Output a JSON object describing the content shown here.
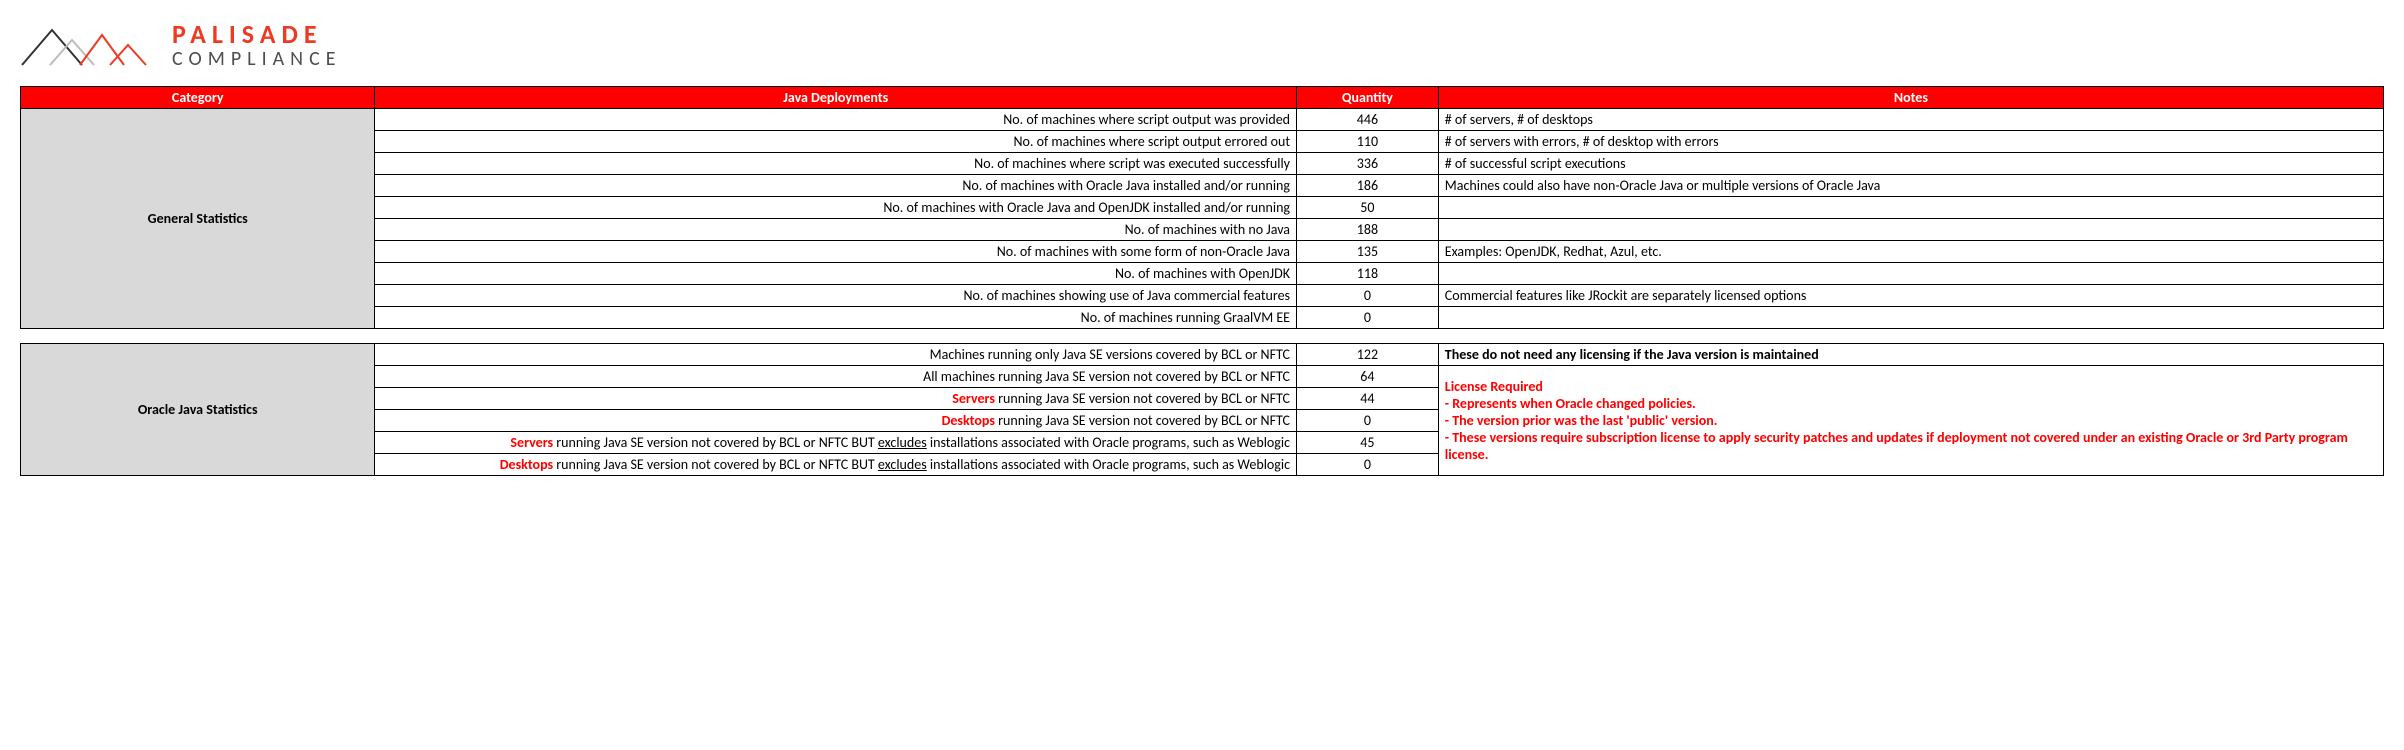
{
  "brand": {
    "line1": "PALISADE",
    "line2": "COMPLIANCE"
  },
  "headers": {
    "category": "Category",
    "deployments": "Java Deployments",
    "quantity": "Quantity",
    "notes": "Notes"
  },
  "section1": {
    "category": "General Statistics",
    "rows": [
      {
        "d": "No. of machines where script output was provided",
        "q": "446",
        "n": "# of servers, # of desktops"
      },
      {
        "d": "No. of machines where script output errored out",
        "q": "110",
        "n": "# of servers with errors, # of desktop with errors"
      },
      {
        "d": "No. of machines where script was executed successfully",
        "q": "336",
        "n": "# of successful script executions"
      },
      {
        "d": "No. of machines with Oracle Java installed and/or running",
        "q": "186",
        "n": "Machines could also have non-Oracle Java or multiple versions of Oracle Java"
      },
      {
        "d": "No. of machines with Oracle Java and OpenJDK installed and/or running",
        "q": "50",
        "n": ""
      },
      {
        "d": "No. of machines with no Java",
        "q": "188",
        "n": ""
      },
      {
        "d": "No. of machines with some form of non-Oracle Java",
        "q": "135",
        "n": "Examples: OpenJDK, Redhat, Azul, etc."
      },
      {
        "d": "No. of machines with OpenJDK",
        "q": "118",
        "n": ""
      },
      {
        "d": "No. of machines showing use of Java commercial features",
        "q": "0",
        "n": "Commercial features like JRockit are separately licensed options"
      },
      {
        "d": "No. of machines running GraalVM EE",
        "q": "0",
        "n": ""
      }
    ]
  },
  "section2": {
    "category": "Oracle Java Statistics",
    "row0": {
      "d": "Machines running only Java SE versions covered by BCL or NFTC",
      "q": "122",
      "n": "These do not need any licensing if the Java version is maintained"
    },
    "row1": {
      "d": "All machines running Java SE version not covered by BCL or NFTC",
      "q": "64"
    },
    "row2": {
      "pre": "Servers",
      "rest": " running Java SE version not covered by BCL or NFTC",
      "q": "44"
    },
    "row3": {
      "pre": "Desktops",
      "rest": " running Java SE version not covered by BCL or NFTC",
      "q": "0"
    },
    "row4": {
      "pre": "Servers",
      "mid": " running Java SE version not covered by BCL or NFTC BUT ",
      "u": "excludes",
      "after": " installations associated with Oracle programs, such as Weblogic",
      "q": "45"
    },
    "row5": {
      "pre": "Desktops",
      "mid": " running Java SE version not covered by BCL or NFTC BUT ",
      "u": "excludes",
      "after": " installations associated with Oracle programs, such as Weblogic",
      "q": "0"
    },
    "note": {
      "l1": "License Required",
      "l2": "- Represents when Oracle changed policies.",
      "l3": "- The version prior was the last 'public' version.",
      "l4": "- These versions require subscription license to apply security patches and updates if deployment not covered under an existing Oracle or 3rd Party program license."
    }
  }
}
